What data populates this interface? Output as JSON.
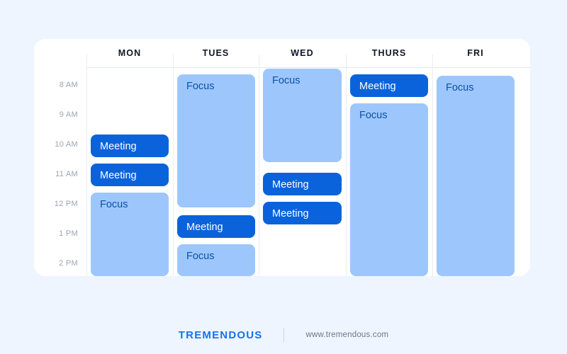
{
  "colors": {
    "page_background": "#eef5ff",
    "card_background": "#ffffff",
    "meeting_fill": "#0b63db",
    "meeting_text": "#ffffff",
    "focus_fill": "#9dc7fc",
    "focus_text": "#0b50ab",
    "brand_blue": "#1372f0",
    "time_label": "#9aa5b4",
    "grid_line": "#e9edf3"
  },
  "calendar": {
    "days": [
      {
        "label": "MON"
      },
      {
        "label": "TUES"
      },
      {
        "label": "WED"
      },
      {
        "label": "THURS"
      },
      {
        "label": "FRI"
      }
    ],
    "time_labels": [
      {
        "label": "8 AM"
      },
      {
        "label": "9 AM"
      },
      {
        "label": "10 AM"
      },
      {
        "label": "11 AM"
      },
      {
        "label": "12 PM"
      },
      {
        "label": "1 PM"
      },
      {
        "label": "2 PM"
      }
    ],
    "events": [
      {
        "day": "MON",
        "type": "meeting",
        "label": "Meeting"
      },
      {
        "day": "MON",
        "type": "meeting",
        "label": "Meeting"
      },
      {
        "day": "MON",
        "type": "focus",
        "label": "Focus"
      },
      {
        "day": "TUES",
        "type": "focus",
        "label": "Focus"
      },
      {
        "day": "TUES",
        "type": "meeting",
        "label": "Meeting"
      },
      {
        "day": "TUES",
        "type": "focus",
        "label": "Focus"
      },
      {
        "day": "WED",
        "type": "focus",
        "label": "Focus"
      },
      {
        "day": "WED",
        "type": "meeting",
        "label": "Meeting"
      },
      {
        "day": "WED",
        "type": "meeting",
        "label": "Meeting"
      },
      {
        "day": "THURS",
        "type": "meeting",
        "label": "Meeting"
      },
      {
        "day": "THURS",
        "type": "focus",
        "label": "Focus"
      },
      {
        "day": "FRI",
        "type": "focus",
        "label": "Focus"
      }
    ]
  },
  "footer": {
    "brand": "TREMENDOUS",
    "url": "www.tremendous.com"
  }
}
